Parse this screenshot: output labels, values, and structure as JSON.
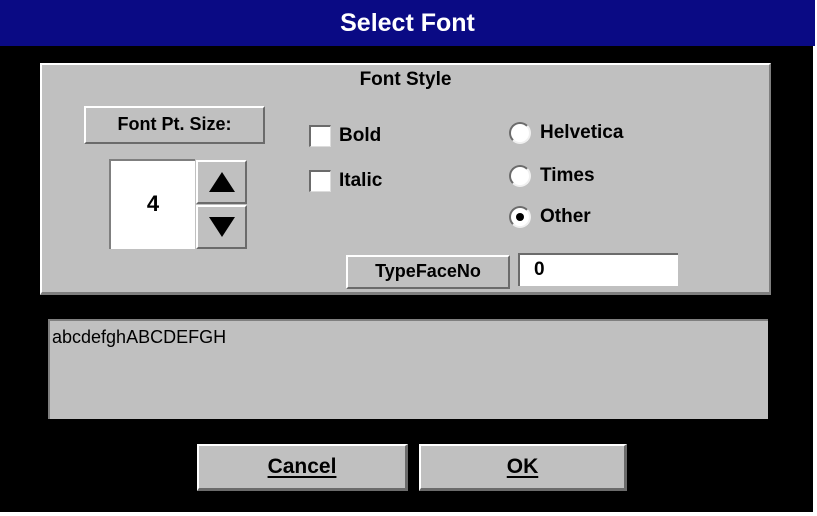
{
  "window": {
    "title": "Select Font"
  },
  "font_style": {
    "legend": "Font Style",
    "size_label": "Font Pt. Size:",
    "size_value": "4",
    "styles": [
      {
        "label": "Bold",
        "checked": false
      },
      {
        "label": "Italic",
        "checked": false
      }
    ],
    "typefaces": [
      {
        "label": "Helvetica",
        "selected": false
      },
      {
        "label": "Times",
        "selected": false
      },
      {
        "label": "Other",
        "selected": true
      }
    ],
    "typeface_no_label": "TypeFaceNo",
    "typeface_no_value": "0"
  },
  "preview": {
    "text": "abcdefghABCDEFGH"
  },
  "buttons": {
    "cancel": "Cancel",
    "ok": "OK"
  },
  "colors": {
    "titlebar": "#0a0a84",
    "face": "#c0c0c0",
    "background": "#000000"
  },
  "icons": {
    "spin_up": "up-arrow-icon",
    "spin_down": "down-arrow-icon"
  }
}
